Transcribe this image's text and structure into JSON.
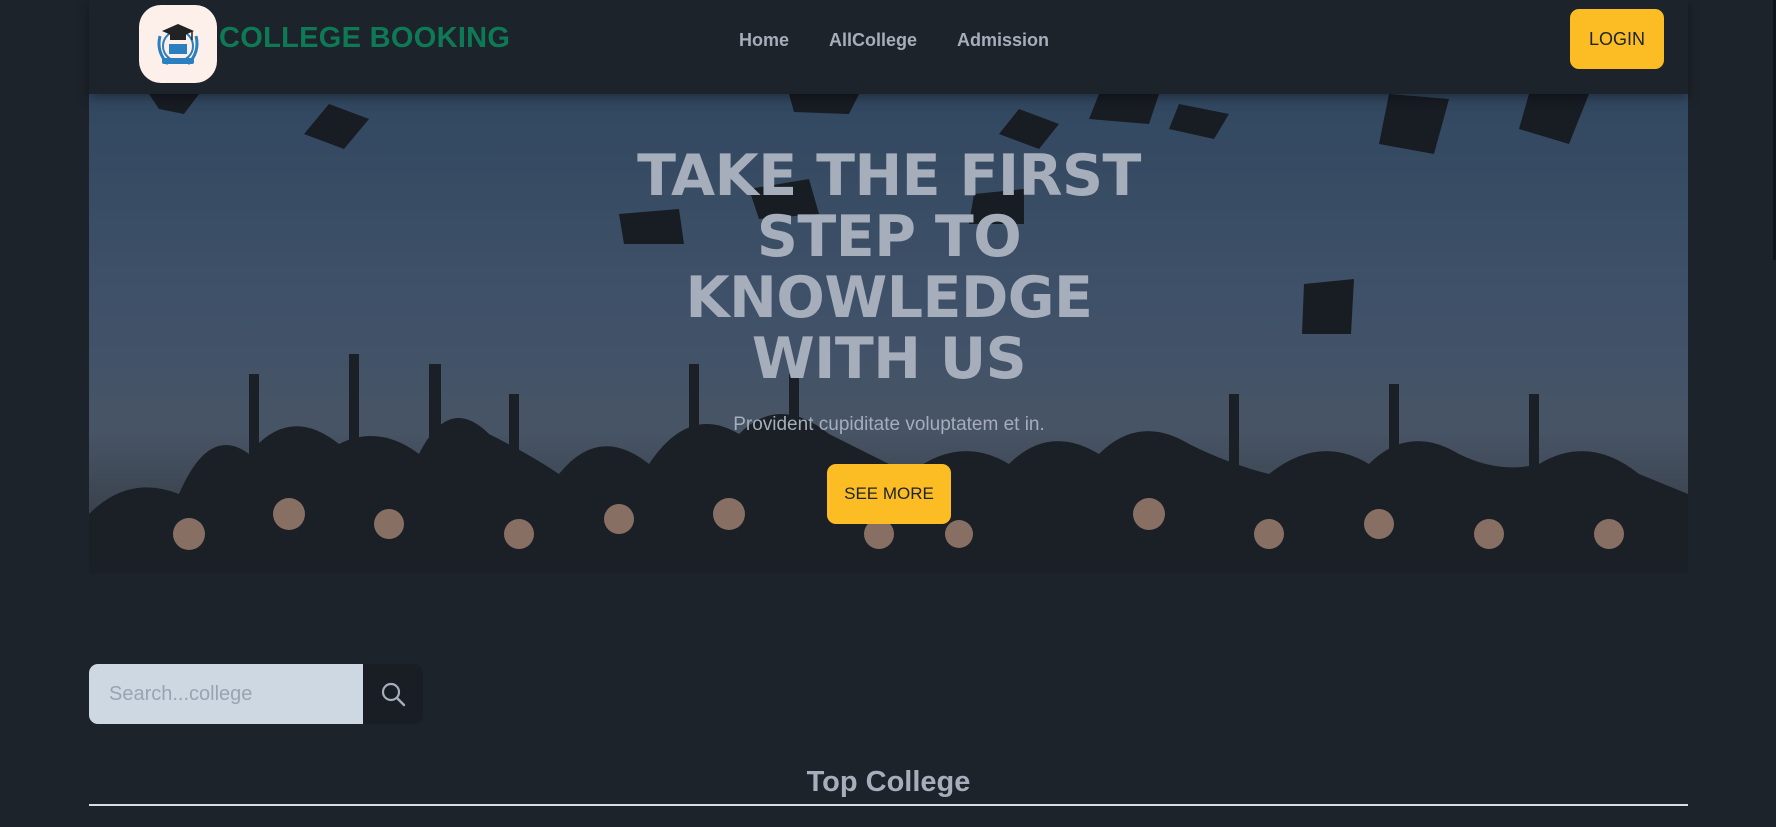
{
  "navbar": {
    "brand": "COLLEGE BOOKING",
    "logo_icon": "graduation-cap-emblem",
    "links": [
      "Home",
      "AllCollege",
      "Admission"
    ],
    "login_label": "LOGIN"
  },
  "hero": {
    "title": "TAKE THE FIRST STEP TO KNOWLEDGE WITH US",
    "subtitle": "Provident cupiditate voluptatem et in.",
    "cta_label": "SEE MORE"
  },
  "search": {
    "placeholder": "Search...college",
    "icon": "search-icon"
  },
  "section": {
    "title": "Top College"
  },
  "colors": {
    "background": "#1d232a",
    "accent": "#fbbd23",
    "brand": "#0e7a55",
    "text": "#a6adbb"
  }
}
